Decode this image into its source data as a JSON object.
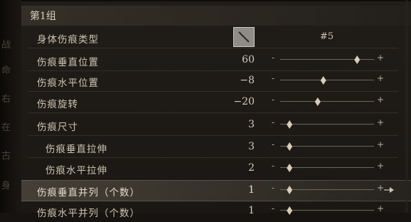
{
  "group": {
    "title": "第1组"
  },
  "rows": [
    {
      "label": "身体伤痕类型",
      "swatch_label": "#5"
    },
    {
      "label": "伤痕垂直位置",
      "value": "60",
      "level": 0.82
    },
    {
      "label": "伤痕水平位置",
      "value": "−8",
      "level": 0.46
    },
    {
      "label": "伤痕旋转",
      "value": "−20",
      "level": 0.4
    },
    {
      "label": "伤痕尺寸",
      "value": "3",
      "level": 0.1
    },
    {
      "label": "伤痕垂直拉伸",
      "value": "3",
      "level": 0.1
    },
    {
      "label": "伤痕水平拉伸",
      "value": "2",
      "level": 0.1
    },
    {
      "label": "伤痕垂直并列（个数）",
      "value": "1",
      "level": 0.1
    },
    {
      "label": "伤痕水平并列（个数）",
      "value": "1",
      "level": 0.1
    }
  ],
  "slider_symbols": {
    "minus": "-",
    "plus": "+"
  },
  "side_glyphs": [
    "战",
    "命",
    "右",
    "在",
    "古",
    "身"
  ],
  "colors": {
    "accent": "#d8ceb8",
    "background": "#1d1a16",
    "swatch": "#8f8b86"
  },
  "icons": {
    "swatch": "dash-mark-swatch",
    "selected_arrow": "arrow-right-icon"
  }
}
